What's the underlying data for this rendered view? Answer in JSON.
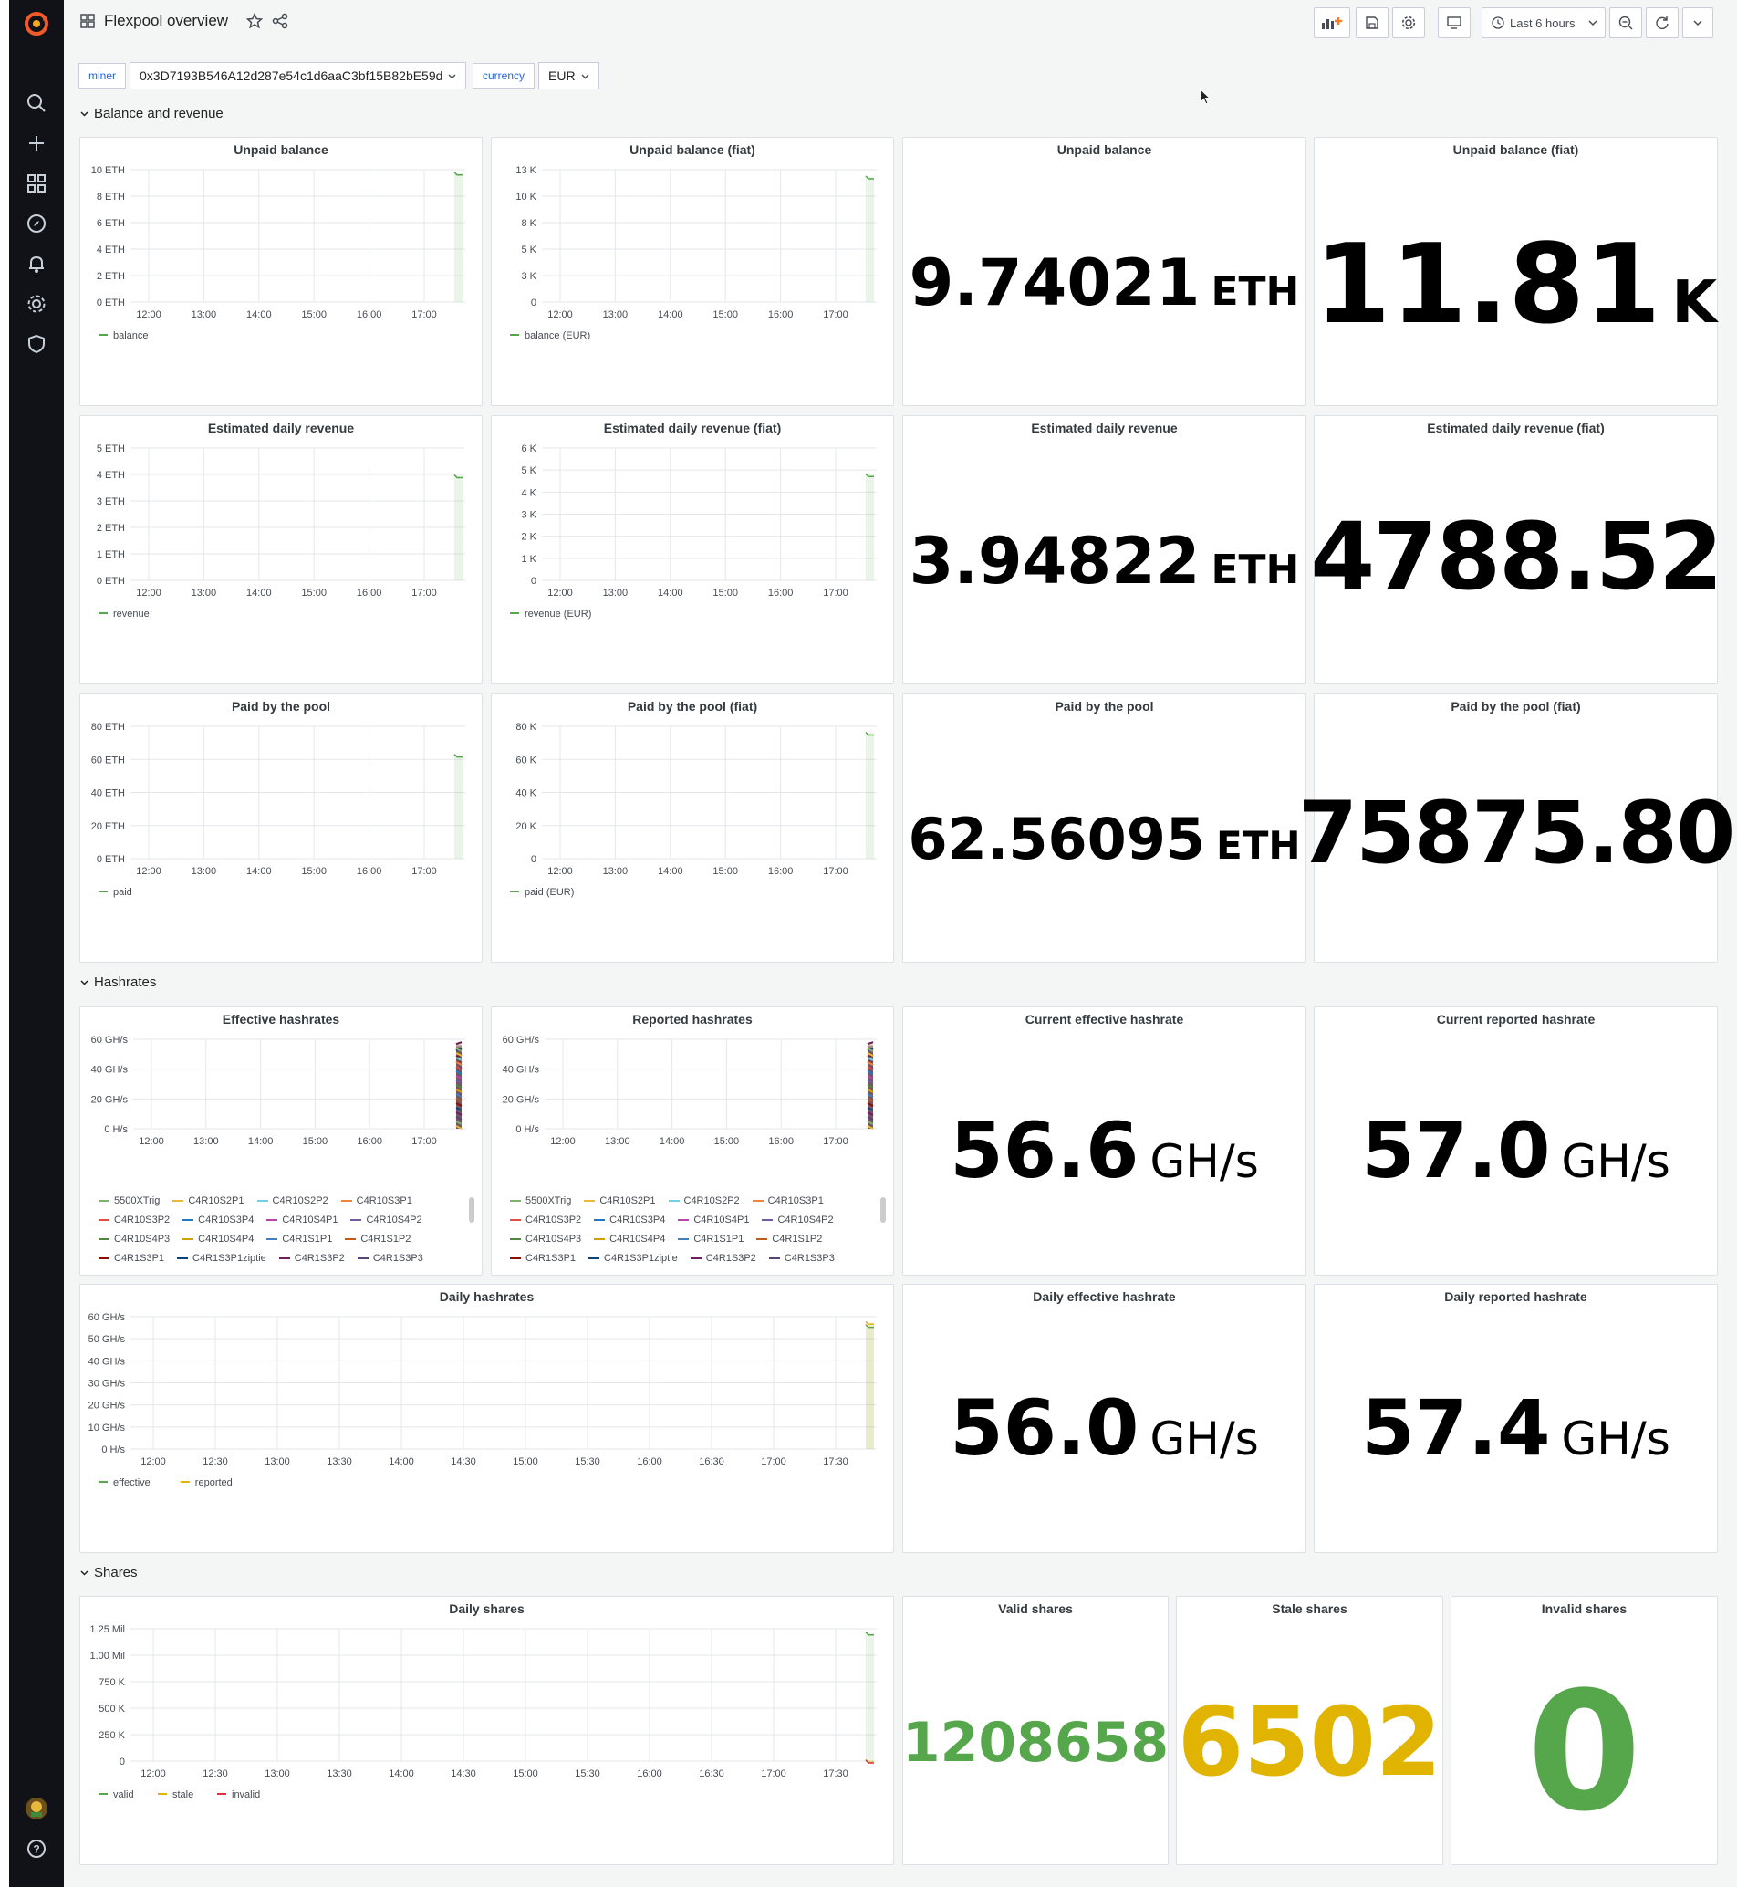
{
  "dashboard": {
    "title": "Flexpool overview"
  },
  "toolbar": {
    "time_range": "Last 6 hours"
  },
  "variables": [
    {
      "label": "miner",
      "value": "0x3D7193B546A12d287e54c1d6aaC3bf15B82bE59d"
    },
    {
      "label": "currency",
      "value": "EUR"
    }
  ],
  "rows": {
    "balance": "Balance and revenue",
    "hashrates": "Hashrates",
    "shares": "Shares"
  },
  "colors": {
    "green": "#56a64b",
    "yellow": "#e0b400",
    "red": "#e02f44",
    "accent": "#1f62e0",
    "logo": "#f05a28"
  },
  "stats": {
    "unpaid_balance": {
      "title": "Unpaid balance",
      "value": "9.74021",
      "unit": "ETH"
    },
    "unpaid_balance_fiat": {
      "title": "Unpaid balance (fiat)",
      "value": "11.81",
      "unit": "K"
    },
    "est_daily_revenue": {
      "title": "Estimated daily revenue",
      "value": "3.94822",
      "unit": "ETH"
    },
    "est_daily_revenue_fiat": {
      "title": "Estimated daily revenue (fiat)",
      "value": "4788.52",
      "unit": ""
    },
    "paid": {
      "title": "Paid by the pool",
      "value": "62.56095",
      "unit": "ETH"
    },
    "paid_fiat": {
      "title": "Paid by the pool (fiat)",
      "value": "75875.80",
      "unit": ""
    },
    "cur_eff_hash": {
      "title": "Current effective hashrate",
      "value": "56.6",
      "unit": "GH/s"
    },
    "cur_rep_hash": {
      "title": "Current reported hashrate",
      "value": "57.0",
      "unit": "GH/s"
    },
    "daily_eff_hash": {
      "title": "Daily effective hashrate",
      "value": "56.0",
      "unit": "GH/s"
    },
    "daily_rep_hash": {
      "title": "Daily reported hashrate",
      "value": "57.4",
      "unit": "GH/s"
    },
    "valid_shares": {
      "title": "Valid shares",
      "value": "1208658"
    },
    "stale_shares": {
      "title": "Stale shares",
      "value": "6502"
    },
    "invalid_shares": {
      "title": "Invalid shares",
      "value": "0"
    }
  },
  "chart_data": [
    {
      "id": "c1",
      "type": "line",
      "title": "Unpaid balance",
      "x": [
        "12:00",
        "13:00",
        "14:00",
        "15:00",
        "16:00",
        "17:00"
      ],
      "y_ticks": [
        "0 ETH",
        "2 ETH",
        "4 ETH",
        "6 ETH",
        "8 ETH",
        "10 ETH"
      ],
      "ylim": [
        0,
        10
      ],
      "series": [
        {
          "name": "balance",
          "color": "#56a64b",
          "last_value": 9.74
        }
      ]
    },
    {
      "id": "c2",
      "type": "line",
      "title": "Unpaid balance (fiat)",
      "x": [
        "12:00",
        "13:00",
        "14:00",
        "15:00",
        "16:00",
        "17:00"
      ],
      "y_ticks": [
        "0",
        "3 K",
        "5 K",
        "8 K",
        "10 K",
        "13 K"
      ],
      "ylim": [
        0,
        12500
      ],
      "series": [
        {
          "name": "balance (EUR)",
          "color": "#56a64b",
          "last_value": 11810
        }
      ]
    },
    {
      "id": "c3",
      "type": "line",
      "title": "Estimated daily revenue",
      "x": [
        "12:00",
        "13:00",
        "14:00",
        "15:00",
        "16:00",
        "17:00"
      ],
      "y_ticks": [
        "0 ETH",
        "1 ETH",
        "2 ETH",
        "3 ETH",
        "4 ETH",
        "5 ETH"
      ],
      "ylim": [
        0,
        5
      ],
      "series": [
        {
          "name": "revenue",
          "color": "#56a64b",
          "last_value": 3.95
        }
      ]
    },
    {
      "id": "c4",
      "type": "line",
      "title": "Estimated daily revenue (fiat)",
      "x": [
        "12:00",
        "13:00",
        "14:00",
        "15:00",
        "16:00",
        "17:00"
      ],
      "y_ticks": [
        "0",
        "1 K",
        "2 K",
        "3 K",
        "4 K",
        "5 K",
        "6 K"
      ],
      "ylim": [
        0,
        6000
      ],
      "series": [
        {
          "name": "revenue (EUR)",
          "color": "#56a64b",
          "last_value": 4788
        }
      ]
    },
    {
      "id": "c5",
      "type": "line",
      "title": "Paid by the pool",
      "x": [
        "12:00",
        "13:00",
        "14:00",
        "15:00",
        "16:00",
        "17:00"
      ],
      "y_ticks": [
        "0 ETH",
        "20 ETH",
        "40 ETH",
        "60 ETH",
        "80 ETH"
      ],
      "ylim": [
        0,
        80
      ],
      "series": [
        {
          "name": "paid",
          "color": "#56a64b",
          "last_value": 62.56
        }
      ]
    },
    {
      "id": "c6",
      "type": "line",
      "title": "Paid by the pool (fiat)",
      "x": [
        "12:00",
        "13:00",
        "14:00",
        "15:00",
        "16:00",
        "17:00"
      ],
      "y_ticks": [
        "0",
        "20 K",
        "40 K",
        "60 K",
        "80 K"
      ],
      "ylim": [
        0,
        80000
      ],
      "series": [
        {
          "name": "paid (EUR)",
          "color": "#56a64b",
          "last_value": 75876
        }
      ]
    },
    {
      "id": "c7",
      "type": "line",
      "title": "Effective hashrates",
      "x": [
        "12:00",
        "13:00",
        "14:00",
        "15:00",
        "16:00",
        "17:00"
      ],
      "y_ticks": [
        "0 H/s",
        "20 GH/s",
        "40 GH/s",
        "60 GH/s"
      ],
      "ylim": [
        0,
        60
      ],
      "series_names": [
        "5500XTrig",
        "C4R10S2P1",
        "C4R10S2P2",
        "C4R10S3P1",
        "C4R10S3P2",
        "C4R10S3P4",
        "C4R10S4P1",
        "C4R10S4P2",
        "C4R10S4P3",
        "C4R10S4P4",
        "C4R1S1P1",
        "C4R1S1P2",
        "C4R1S3P1",
        "C4R1S3P1ziptie",
        "C4R1S3P2",
        "C4R1S3P3"
      ]
    },
    {
      "id": "c8",
      "type": "line",
      "title": "Reported hashrates",
      "x": [
        "12:00",
        "13:00",
        "14:00",
        "15:00",
        "16:00",
        "17:00"
      ],
      "y_ticks": [
        "0 H/s",
        "20 GH/s",
        "40 GH/s",
        "60 GH/s"
      ],
      "ylim": [
        0,
        60
      ],
      "series_names": [
        "5500XTrig",
        "C4R10S2P1",
        "C4R10S2P2",
        "C4R10S3P1",
        "C4R10S3P2",
        "C4R10S3P4",
        "C4R10S4P1",
        "C4R10S4P2",
        "C4R10S4P3",
        "C4R10S4P4",
        "C4R1S1P1",
        "C4R1S1P2",
        "C4R1S3P1",
        "C4R1S3P1ziptie",
        "C4R1S3P2",
        "C4R1S3P3"
      ]
    },
    {
      "id": "c9",
      "type": "line",
      "title": "Daily hashrates",
      "x": [
        "12:00",
        "12:30",
        "13:00",
        "13:30",
        "14:00",
        "14:30",
        "15:00",
        "15:30",
        "16:00",
        "16:30",
        "17:00",
        "17:30"
      ],
      "y_ticks": [
        "0 H/s",
        "10 GH/s",
        "20 GH/s",
        "30 GH/s",
        "40 GH/s",
        "50 GH/s",
        "60 GH/s"
      ],
      "ylim": [
        0,
        60
      ],
      "series": [
        {
          "name": "effective",
          "color": "#56a64b",
          "last_value": 56.0
        },
        {
          "name": "reported",
          "color": "#e0b400",
          "last_value": 57.4
        }
      ]
    },
    {
      "id": "c10",
      "type": "line",
      "title": "Daily shares",
      "x": [
        "12:00",
        "12:30",
        "13:00",
        "13:30",
        "14:00",
        "14:30",
        "15:00",
        "15:30",
        "16:00",
        "16:30",
        "17:00",
        "17:30"
      ],
      "y_ticks": [
        "0",
        "250 K",
        "500 K",
        "750 K",
        "1.00 Mil",
        "1.25 Mil"
      ],
      "ylim": [
        0,
        1250000
      ],
      "series": [
        {
          "name": "valid",
          "color": "#56a64b",
          "last_value": 1208658
        },
        {
          "name": "stale",
          "color": "#e0b400",
          "last_value": 6502
        },
        {
          "name": "invalid",
          "color": "#e02f44",
          "last_value": 0
        }
      ]
    }
  ]
}
